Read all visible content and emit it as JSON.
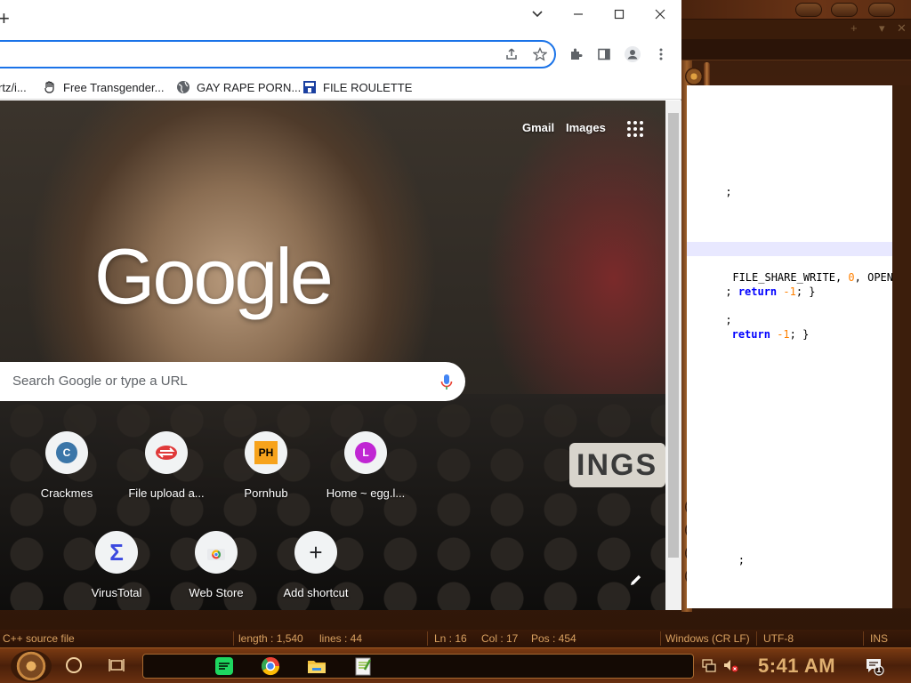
{
  "notepadpp": {
    "code_lines": [
      {
        "pre": "",
        "text": ";"
      },
      {
        "pre": "",
        "text": "FILE_SHARE_WRITE, ",
        "num": "0",
        "post": ", OPEN_EX"
      },
      {
        "pre": "; ",
        "kw": "return",
        "num": "-1",
        "post": "; }"
      },
      {
        "pre": "",
        "text": ";"
      },
      {
        "pre": " ",
        "kw": "return",
        "num": "-1",
        "post": "; }"
      },
      {
        "pre": "",
        "text": "  ;"
      }
    ],
    "status": {
      "file_type": "C++ source file",
      "length": "length : 1,540",
      "lines": "lines : 44",
      "ln": "Ln : 16",
      "col": "Col : 17",
      "pos": "Pos : 454",
      "eol": "Windows (CR LF)",
      "encoding": "UTF-8",
      "mode": "INS"
    }
  },
  "chrome": {
    "new_tab_symbol": "+",
    "window_controls": {
      "chevron": "⌄",
      "minimize": "—",
      "maximize": "☐",
      "close": "✕"
    },
    "bookmarks": [
      {
        "label": "rtz/i...",
        "icon": "none"
      },
      {
        "label": "Free Transgender...",
        "icon": "hand-icon"
      },
      {
        "label": "GAY RAPE PORN...",
        "icon": "globe-icon"
      },
      {
        "label": "FILE ROULETTE",
        "icon": "mft-icon"
      }
    ],
    "ntp": {
      "top_links": [
        "Gmail",
        "Images"
      ],
      "logo_text": "Google",
      "search_placeholder": "Search Google or type a URL",
      "shortcuts": [
        {
          "label": "Crackmes",
          "badge": "C",
          "badge_color": "#3b76a8"
        },
        {
          "label": "File upload a...",
          "badge": "",
          "badge_color": "#e03a3a"
        },
        {
          "label": "Pornhub",
          "badge": "PH",
          "badge_color": "#f7a31c"
        },
        {
          "label": "Home ~ egg.l...",
          "badge": "L",
          "badge_color": "#c026d3"
        },
        {
          "label": "VirusTotal",
          "badge": "Σ",
          "badge_color": "#3b49df"
        },
        {
          "label": "Web Store",
          "badge": "",
          "badge_color": "#4285f4"
        },
        {
          "label": "Add shortcut",
          "badge": "+",
          "badge_color": "#202124"
        }
      ],
      "background_sign": "INGS"
    }
  },
  "taskbar": {
    "clock": "5:41 AM",
    "notification_count": "1"
  }
}
